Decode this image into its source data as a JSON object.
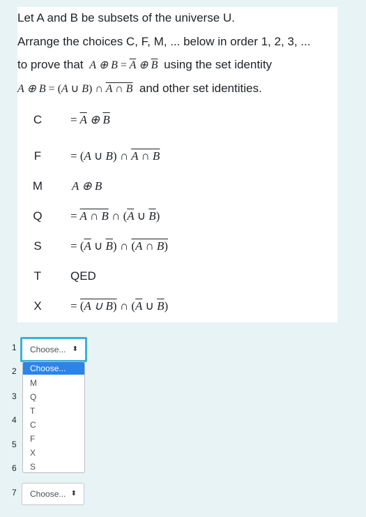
{
  "question": {
    "line1": "Let A and B be subsets of the universe U.",
    "line2": "Arrange the choices C, F, M, ... below in order 1, 2, 3, ...",
    "line3_prefix": "to prove that",
    "line3_suffix": "using the set identity",
    "line4_suffix": "and other set identities."
  },
  "choices": [
    {
      "letter": "C",
      "expr": "= Ā ⊕ B̄"
    },
    {
      "letter": "F",
      "expr": "= (A ∪ B) ∩ A̅∩B̅"
    },
    {
      "letter": "M",
      "expr": "A ⊕ B"
    },
    {
      "letter": "Q",
      "expr": "= A̅∩B̅ ∩ (Ā ∪ B̄)"
    },
    {
      "letter": "S",
      "expr": "= (Ā ∪ B̄) ∩ (Ā∩B̄)"
    },
    {
      "letter": "T",
      "expr": "QED"
    },
    {
      "letter": "X",
      "expr": "= (A̅∪B̅) ∩ (Ā ∪ B̄)"
    }
  ],
  "answers": {
    "numbers": [
      "1",
      "2",
      "3",
      "4",
      "5",
      "6",
      "7"
    ],
    "select1_value": "Choose...",
    "select7_value": "Choose...",
    "dropdown_options": [
      "Choose...",
      "M",
      "Q",
      "T",
      "C",
      "F",
      "X",
      "S"
    ]
  },
  "colors": {
    "highlight": "#2b84e9",
    "focus_border": "#3bb1da",
    "page_bg": "#e7f3f5"
  }
}
